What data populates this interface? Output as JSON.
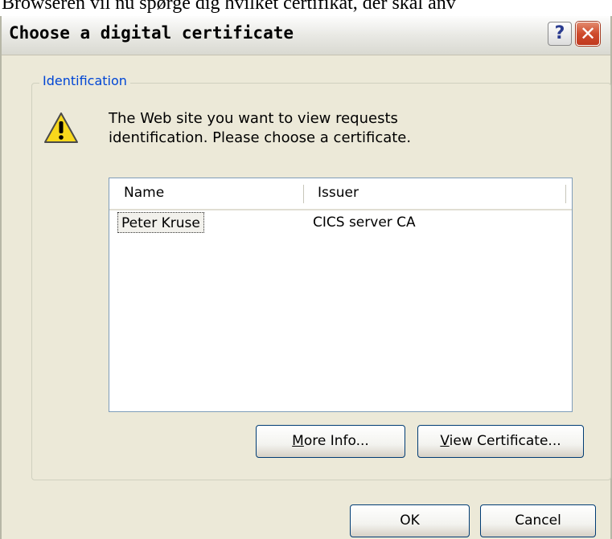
{
  "background_text": "Browseren vil nu spørge dig hvilket certifikat, der skal anv",
  "window": {
    "title": "Choose a digital certificate",
    "help_glyph": "?",
    "close_glyph": "✕"
  },
  "group": {
    "label": "Identification",
    "icon": "warning-icon",
    "message_line1": "The Web site you want to view requests",
    "message_line2": "identification. Please choose a certificate."
  },
  "certificate_list": {
    "columns": [
      "Name",
      "Issuer"
    ],
    "rows": [
      {
        "name": "Peter Kruse",
        "issuer": "CICS server CA"
      }
    ]
  },
  "buttons": {
    "more_info_mnemonic": "M",
    "more_info_rest": "ore Info...",
    "view_certificate_mnemonic": "V",
    "view_certificate_rest": "iew Certificate...",
    "ok": "OK",
    "cancel": "Cancel"
  },
  "colors": {
    "dialog_bg": "#ece9d8",
    "group_label": "#0046d5",
    "close_button": "#cf4b2c"
  }
}
